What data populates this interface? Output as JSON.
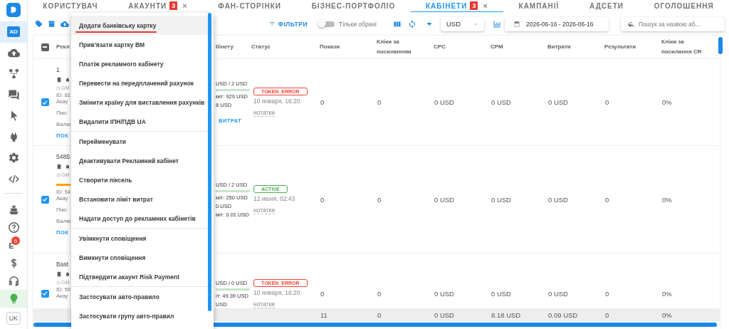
{
  "tabs": [
    {
      "label": "КОРИСТУВАЧ",
      "selected": false
    },
    {
      "label": "АКАУНТИ",
      "badge": "3",
      "close": "×",
      "selected": false
    },
    {
      "label": "ФАН-СТОРІНКИ",
      "selected": false
    },
    {
      "label": "БІЗНЕС-ПОРТФОЛІО",
      "selected": false
    },
    {
      "label": "КАБІНЕТИ",
      "badge": "3",
      "close": "×",
      "selected": true
    },
    {
      "label": "КАМПАНІЇ",
      "selected": false
    },
    {
      "label": "АДСЕТИ",
      "selected": false
    },
    {
      "label": "ОГОЛОШЕННЯ",
      "selected": false
    }
  ],
  "sidebar": {
    "top_items": [
      {
        "kind": "label",
        "label": "AD",
        "selected": true
      },
      {
        "kind": "cloud-upload",
        "selected": false
      },
      {
        "kind": "hierarchy",
        "selected": false
      },
      {
        "kind": "chat",
        "selected": false
      },
      {
        "kind": "cursor",
        "selected": false
      },
      {
        "kind": "plug",
        "selected": false
      },
      {
        "kind": "gear",
        "selected": false
      },
      {
        "kind": "code",
        "selected": false
      }
    ],
    "bottom_items": [
      {
        "kind": "ship",
        "selected": false
      },
      {
        "kind": "help",
        "selected": false
      },
      {
        "kind": "label",
        "label": "E",
        "badge": "6",
        "selected": false
      },
      {
        "kind": "dollar",
        "selected": false
      },
      {
        "kind": "headset",
        "selected": false
      },
      {
        "kind": "bulb",
        "selected": true
      }
    ],
    "language": "UK"
  },
  "toolbar": {
    "filter_button": "ФІЛЬТРИ",
    "toggle": {
      "label": "Тільки обрані",
      "on": false
    },
    "currency": "USD",
    "date_range": "2026-06-16 - 2026-06-16",
    "search": {
      "placeholder": "Пошук за назвою аб..."
    }
  },
  "context_menu": {
    "groups": [
      [
        {
          "label": "Додати банківську картку",
          "highlighted": true
        },
        {
          "label": "Прив'язати картку BM",
          "highlighted": false
        },
        {
          "label": "Платіж рекламного кабінету",
          "highlighted": false
        },
        {
          "label": "Перевести на передплачений рахунок",
          "highlighted": false
        },
        {
          "label": "Змінити країну для виставлення рахунків",
          "highlighted": false
        },
        {
          "label": "Видалити ІПН/ПДВ UA",
          "highlighted": false
        }
      ],
      [
        {
          "label": "Перейменувати",
          "highlighted": false
        },
        {
          "label": "Деактивувати Рекламний кабінет",
          "highlighted": false
        },
        {
          "label": "Створити піксель",
          "highlighted": false
        },
        {
          "label": "Встановити ліміт витрат",
          "highlighted": false
        },
        {
          "label": "Надати доступ до рекламних кабінетів",
          "highlighted": false
        }
      ],
      [
        {
          "label": "Увімкнути сповіщення",
          "highlighted": false
        },
        {
          "label": "Вимкнути сповіщення",
          "highlighted": false
        },
        {
          "label": "Підтвердити акаунт Risk Payment",
          "highlighted": false
        }
      ],
      [
        {
          "label": "Застосувати авто-правило",
          "highlighted": false
        },
        {
          "label": "Застосувати групу авто-правил",
          "highlighted": false
        }
      ]
    ]
  },
  "table": {
    "select_all_indeterminate": true,
    "columns": [
      "Рекл",
      "бінету",
      "Статус",
      "Покази",
      "Кліки за посиланням",
      "CPC",
      "CPM",
      "Витрати",
      "Результати",
      "Кліки за посилання CR"
    ],
    "rows": [
      {
        "checked": true,
        "name": "1",
        "gm": "GM",
        "id": "ID: 81",
        "account": "Акау",
        "pixel": "Пікс",
        "currency": "Валю",
        "link": "ПОК",
        "alert": false,
        "budget": {
          "spent": "USD / 2 USD",
          "level": 1,
          "lines": [
            "міт: 929 USD",
            "8 USD"
          ],
          "link": "ВИТРАТ"
        },
        "status": {
          "label": "TOKEN_ERROR",
          "kind": "error"
        },
        "date": "10 января, 16:20",
        "notes": "нотатки",
        "metrics": [
          "0",
          "0",
          "0 USD",
          "0 USD",
          "0 USD",
          "0",
          "0%"
        ]
      },
      {
        "checked": true,
        "name": "5485",
        "gm": "GM",
        "id": "ID: 54",
        "account": "Акау",
        "pixel": "Пікс",
        "currency": "Валю",
        "link": "ПОК",
        "alert": true,
        "budget": {
          "spent": "USD / 2 USD",
          "level": 1,
          "lines": [
            "міт: 250 USD",
            "0 USD",
            "міт: 0.01 USD"
          ]
        },
        "status": {
          "label": "ACTIVE",
          "kind": "active"
        },
        "date": "12 июня, 02:43",
        "notes": "нотатки",
        "metrics": [
          "0",
          "0",
          "0 USD",
          "0 USD",
          "0 USD",
          "0",
          "0%"
        ]
      },
      {
        "checked": true,
        "name": "Bast",
        "gm": "GM",
        "id": "ID: 59",
        "account": "Акау",
        "alert": false,
        "budget": {
          "spent": "USD / 0 USD",
          "level": 1,
          "lines": [
            "іт: 49.39 USD",
            "USD"
          ]
        },
        "status": {
          "label": "TOKEN_ERROR",
          "kind": "error"
        },
        "date": "10 января, 16:20",
        "notes": "нотатки",
        "metrics": [
          "0",
          "0",
          "0 USD",
          "0 USD",
          "0 USD",
          "0",
          "0%"
        ]
      }
    ],
    "totals": [
      "11",
      "0",
      "0 USD",
      "8.18 USD",
      "0.09 USD",
      "0",
      "0%"
    ]
  }
}
